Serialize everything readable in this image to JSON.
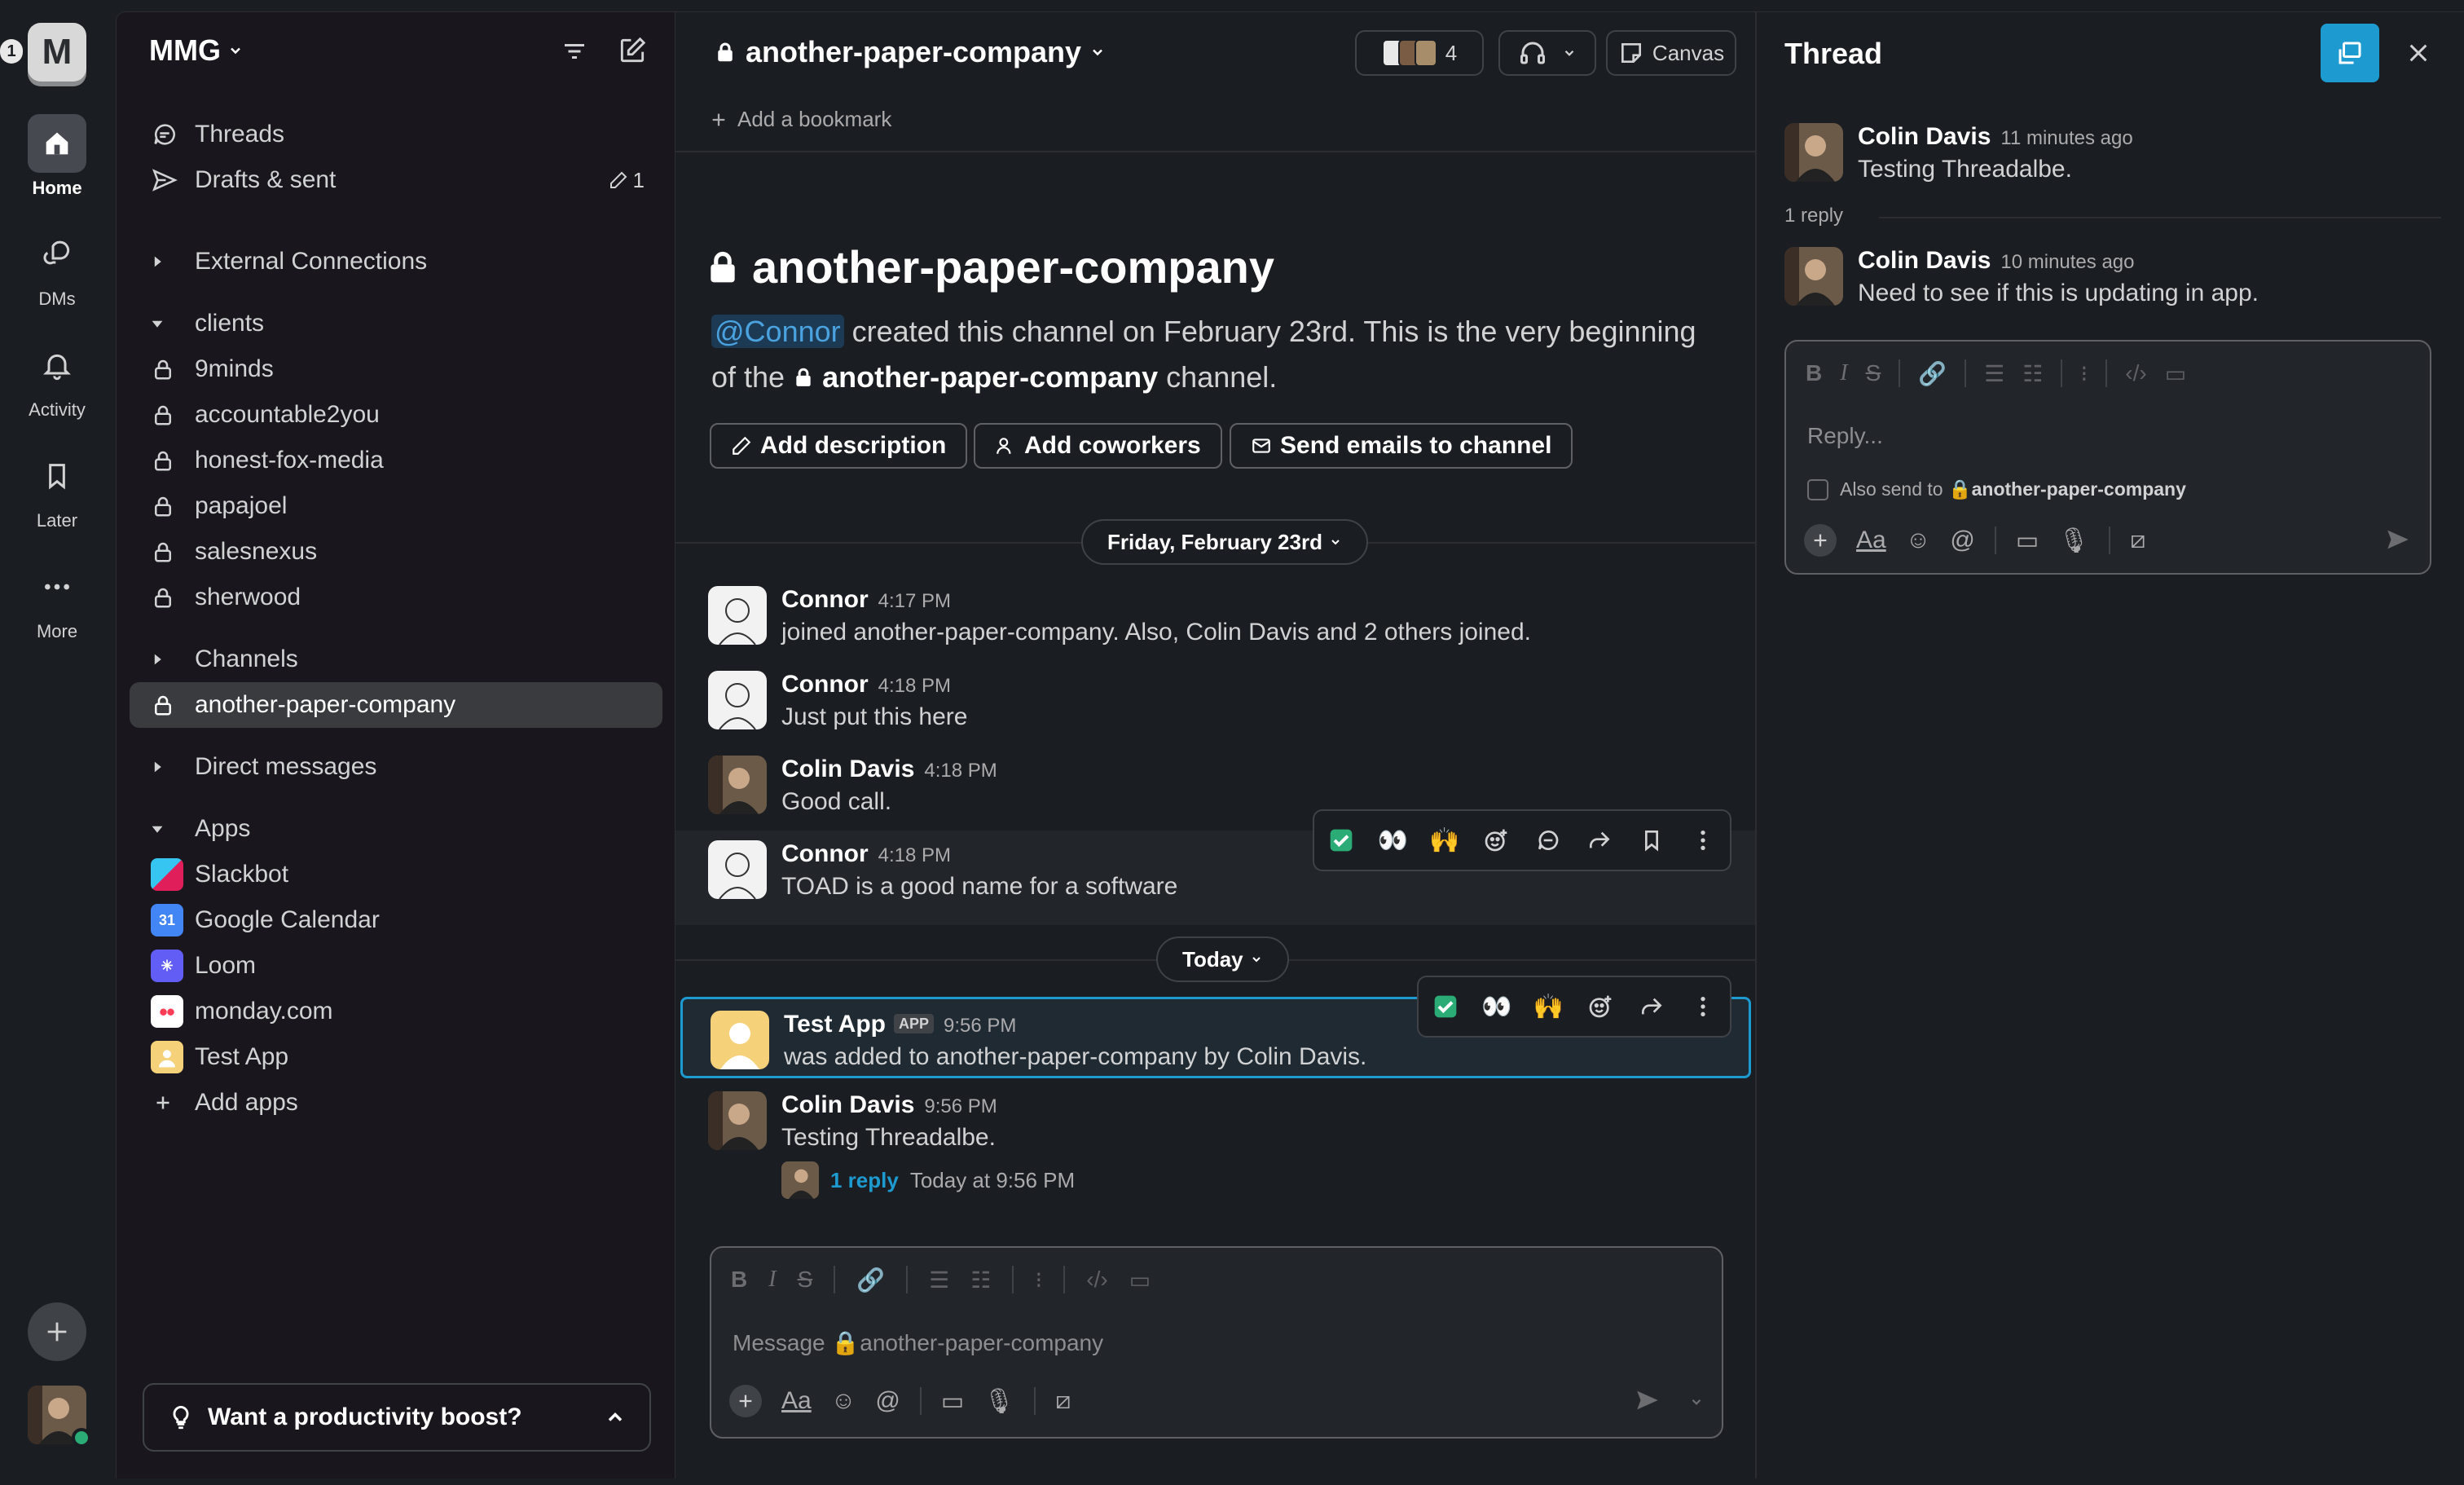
{
  "workspace": {
    "initial": "M",
    "badge": "1",
    "name": "MMG"
  },
  "rail": {
    "home": "Home",
    "dms": "DMs",
    "activity": "Activity",
    "later": "Later",
    "more": "More"
  },
  "sidebar": {
    "threads": "Threads",
    "drafts": "Drafts & sent",
    "drafts_count": "1",
    "external": "External Connections",
    "clients_section": "clients",
    "clients": [
      "9minds",
      "accountable2you",
      "honest-fox-media",
      "papajoel",
      "salesnexus",
      "sherwood"
    ],
    "channels_section": "Channels",
    "selected_channel": "another-paper-company",
    "dms_section": "Direct messages",
    "apps_section": "Apps",
    "apps": [
      {
        "name": "Slackbot",
        "color": "#e01e5a"
      },
      {
        "name": "Google Calendar",
        "color": "#4285f4"
      },
      {
        "name": "Loom",
        "color": "#625df5"
      },
      {
        "name": "monday.com",
        "color": "#ff3d57"
      },
      {
        "name": "Test App",
        "color": "#f2c744"
      }
    ],
    "add_apps": "Add apps",
    "boost": "Want a productivity boost?"
  },
  "channel": {
    "name": "another-paper-company",
    "member_count": "4",
    "canvas": "Canvas",
    "bookmark": "Add a bookmark",
    "intro_mention": "@Connor",
    "intro_text_1": " created this channel on February 23rd. This is the very beginning of the ",
    "intro_text_2": "another-paper-company",
    "intro_text_3": " channel.",
    "btn_description": "Add description",
    "btn_coworkers": "Add coworkers",
    "btn_emails": "Send emails to channel",
    "day1": "Friday, February 23rd",
    "day2": "Today"
  },
  "messages": [
    {
      "name": "Connor",
      "time": "4:17 PM",
      "text": "joined another-paper-company. Also, Colin Davis and 2 others joined."
    },
    {
      "name": "Connor",
      "time": "4:18 PM",
      "text": "Just put this here"
    },
    {
      "name": "Colin Davis",
      "time": "4:18 PM",
      "text": "Good call."
    },
    {
      "name": "Connor",
      "time": "4:18 PM",
      "text": "TOAD is a good name for a software"
    },
    {
      "name": "Test App",
      "tag": "APP",
      "time": "9:56 PM",
      "text": "was added to another-paper-company by Colin Davis."
    },
    {
      "name": "Colin Davis",
      "time": "9:56 PM",
      "text": "Testing Threadalbe.",
      "replies": "1 reply",
      "reply_time": "Today at 9:56 PM"
    }
  ],
  "composer": {
    "placeholder_prefix": "Message ",
    "placeholder_channel": "another-paper-company"
  },
  "thread": {
    "title": "Thread",
    "parent": {
      "name": "Colin Davis",
      "time": "11 minutes ago",
      "text": "Testing Threadalbe."
    },
    "reply_count": "1 reply",
    "reply": {
      "name": "Colin Davis",
      "time": "10 minutes ago",
      "text": "Need to see if this is updating in app."
    },
    "placeholder": "Reply...",
    "also_send_prefix": "Also send to ",
    "also_send_channel": "another-paper-company"
  },
  "icons": [
    "home-icon",
    "dms-icon",
    "bell-icon",
    "bookmark-icon",
    "more-icon",
    "lock-icon",
    "filter-icon",
    "compose-icon",
    "threads-icon",
    "send-icon",
    "headphones-icon",
    "canvas-icon",
    "popout-icon",
    "close-icon",
    "check-emoji",
    "eyes-emoji",
    "raised-hands-emoji"
  ]
}
